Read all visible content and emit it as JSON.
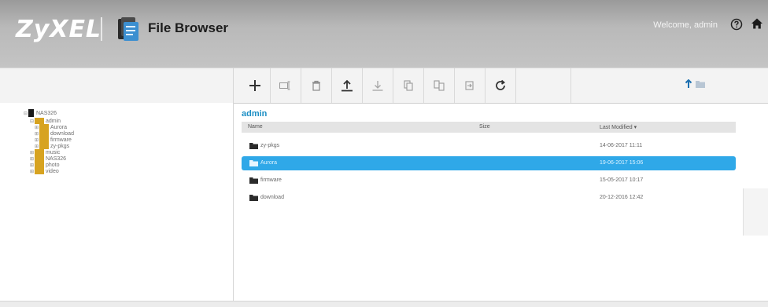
{
  "header": {
    "logo": "ZyXEL",
    "app_title": "File Browser",
    "welcome": "Welcome, admin",
    "help_icon": "help-icon",
    "home_icon": "home-icon"
  },
  "toolbar": {
    "buttons": [
      {
        "name": "add-folder-button",
        "icon": "plus-icon"
      },
      {
        "name": "rename-button",
        "icon": "rename-icon"
      },
      {
        "name": "delete-button",
        "icon": "trash-icon"
      },
      {
        "name": "upload-button",
        "icon": "upload-icon"
      },
      {
        "name": "download-button",
        "icon": "download-icon"
      },
      {
        "name": "copy-button",
        "icon": "copy-icon"
      },
      {
        "name": "move-button",
        "icon": "move-icon"
      },
      {
        "name": "share-button",
        "icon": "share-icon"
      },
      {
        "name": "refresh-button",
        "icon": "refresh-icon"
      }
    ],
    "up_icon": "up-arrow-icon"
  },
  "tree": {
    "root": "NAS326",
    "nodes": [
      {
        "label": "admin",
        "depth": 1,
        "color": "#d7a321"
      },
      {
        "label": "Aurora",
        "depth": 2,
        "color": "#d7a321"
      },
      {
        "label": "download",
        "depth": 2,
        "color": "#d7a321"
      },
      {
        "label": "firmware",
        "depth": 2,
        "color": "#d7a321"
      },
      {
        "label": "zy-pkgs",
        "depth": 2,
        "color": "#d7a321"
      },
      {
        "label": "music",
        "depth": 1,
        "color": "#d7a321"
      },
      {
        "label": "NAS326",
        "depth": 1,
        "color": "#d7a321"
      },
      {
        "label": "photo",
        "depth": 1,
        "color": "#d7a321"
      },
      {
        "label": "video",
        "depth": 1,
        "color": "#d7a321"
      }
    ]
  },
  "main": {
    "breadcrumb": "admin",
    "columns": {
      "name": "Name",
      "size": "Size",
      "modified": "Last Modified ▾"
    },
    "rows": [
      {
        "name": "zy-pkgs",
        "size": "",
        "modified": "14-06-2017 11:11",
        "selected": false
      },
      {
        "name": "Aurora",
        "size": "",
        "modified": "19-06-2017 15:06",
        "selected": true
      },
      {
        "name": "firmware",
        "size": "",
        "modified": "15-05-2017 10:17",
        "selected": false
      },
      {
        "name": "download",
        "size": "",
        "modified": "20-12-2016 12:42",
        "selected": false
      }
    ]
  },
  "colors": {
    "accent": "#2fa8e8",
    "breadcrumb": "#1b8ec4",
    "folder": "#d7a321",
    "header_bg": "#b0b0b0"
  }
}
